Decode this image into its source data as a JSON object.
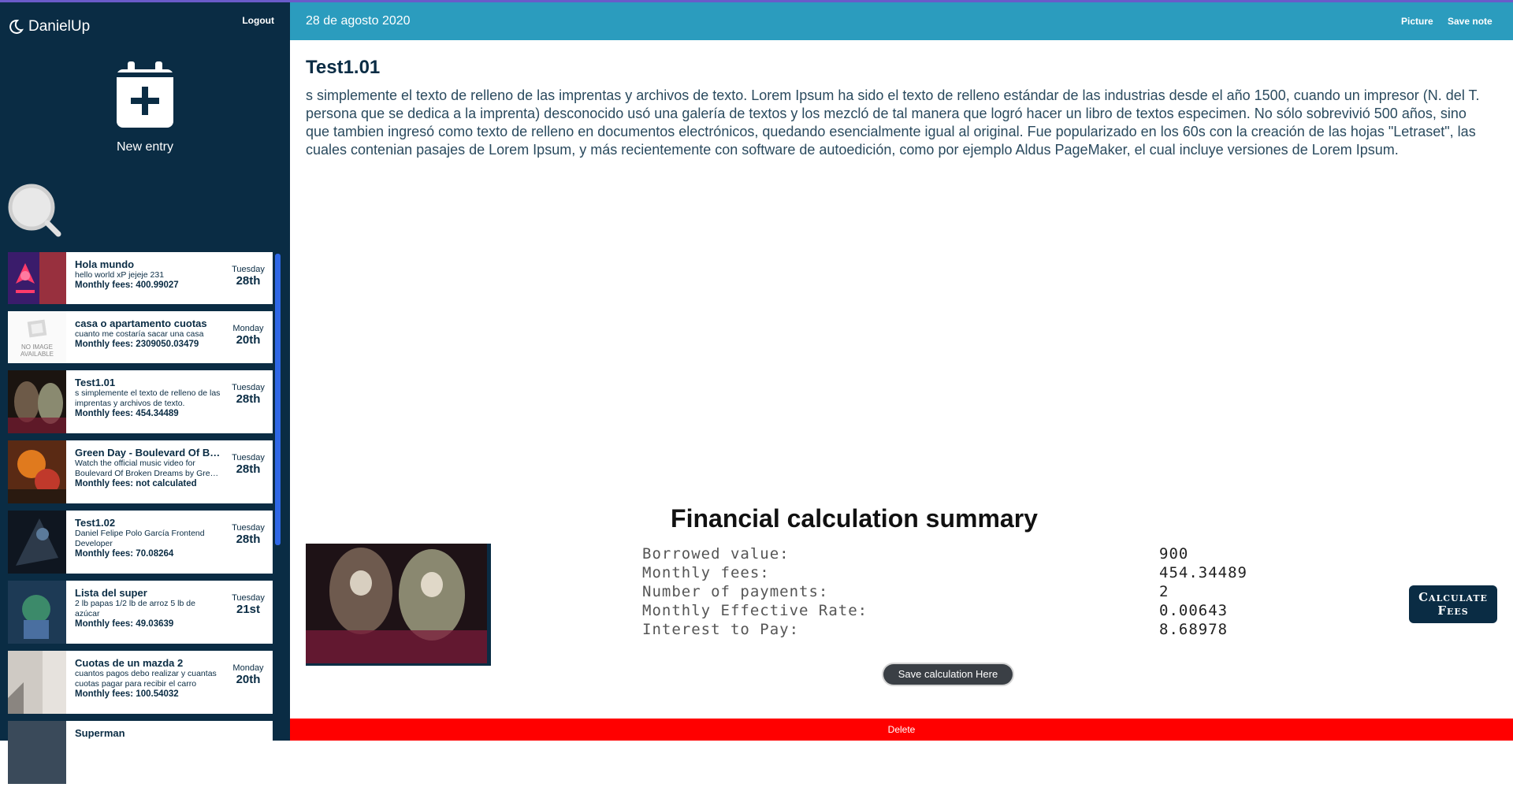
{
  "brand": {
    "name": "DanielUp"
  },
  "sidebar": {
    "logout_label": "Logout",
    "new_entry_label": "New entry",
    "entries": [
      {
        "title": "Hola mundo",
        "desc": "hello world xP jejeje 231",
        "fees": "Monthly fees: 400.99027",
        "weekday": "Tuesday",
        "day": "28th"
      },
      {
        "title": "casa o apartamento cuotas",
        "desc": "cuanto me costaría sacar una casa",
        "fees": "Monthly fees: 2309050.03479",
        "weekday": "Monday",
        "day": "20th"
      },
      {
        "title": "Test1.01",
        "desc": "s simplemente el texto de relleno de las imprentas y archivos de texto.",
        "fees": "Monthly fees: 454.34489",
        "weekday": "Tuesday",
        "day": "28th"
      },
      {
        "title": "Green Day - Boulevard Of Broken Dreams",
        "desc": "Watch the official music video for Boulevard Of Broken Dreams by Green Day",
        "fees": "Monthly fees: not calculated",
        "weekday": "Tuesday",
        "day": "28th"
      },
      {
        "title": "Test1.02",
        "desc": "Daniel Felipe Polo García Frontend Developer",
        "fees": "Monthly fees: 70.08264",
        "weekday": "Tuesday",
        "day": "28th"
      },
      {
        "title": "Lista del super",
        "desc": "2 lb papas 1/2 lb de arroz 5 lb de azúcar",
        "fees": "Monthly fees: 49.03639",
        "weekday": "Tuesday",
        "day": "21st"
      },
      {
        "title": "Cuotas de un mazda 2",
        "desc": "cuantos pagos debo realizar y cuantas cuotas pagar para recibir el carro",
        "fees": "Monthly fees: 100.54032",
        "weekday": "Monday",
        "day": "20th"
      },
      {
        "title": "Superman",
        "desc": "",
        "fees": "",
        "weekday": "",
        "day": ""
      }
    ],
    "no_image_text": "NO IMAGE AVAILABLE"
  },
  "header": {
    "date": "28 de agosto 2020",
    "picture_label": "Picture",
    "save_note_label": "Save note"
  },
  "note": {
    "title": "Test1.01",
    "body": "s simplemente el texto de relleno de las imprentas y archivos de texto. Lorem Ipsum ha sido el texto de relleno estándar de las industrias desde el año 1500, cuando un impresor (N. del T. persona que se dedica a la imprenta) desconocido usó una galería de textos y los mezcló de tal manera que logró hacer un libro de textos especimen. No sólo sobrevivió 500 años, sino que tambien ingresó como texto de relleno en documentos electrónicos, quedando esencialmente igual al original. Fue popularizado en los 60s con la creación de las hojas \"Letraset\", las cuales contenian pasajes de Lorem Ipsum, y más recientemente con software de autoedición, como por ejemplo Aldus PageMaker, el cual incluye versiones de Lorem Ipsum."
  },
  "summary": {
    "title": "Financial calculation summary",
    "rows": [
      {
        "label": "Borrowed value:",
        "value": "900"
      },
      {
        "label": "Monthly fees:",
        "value": "454.34489"
      },
      {
        "label": "Number of payments:",
        "value": "2"
      },
      {
        "label": "Monthly Effective Rate:",
        "value": "0.00643"
      },
      {
        "label": "Interest to Pay:",
        "value": "8.68978"
      }
    ],
    "calculate_label_line1": "Calculate",
    "calculate_label_line2": "Fees",
    "save_calc_label": "Save calculation Here"
  },
  "footer": {
    "delete_label": "Delete"
  },
  "colors": {
    "sidebar": "#0a2c44",
    "header": "#2b9cbe",
    "delete": "#ff0000",
    "scrollbar": "#2e67e6"
  }
}
